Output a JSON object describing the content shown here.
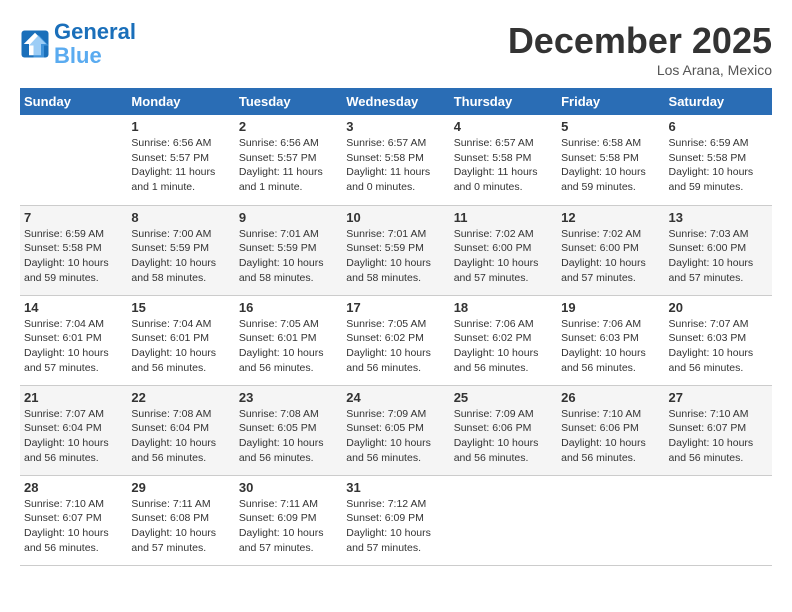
{
  "header": {
    "logo_line1": "General",
    "logo_line2": "Blue",
    "month": "December 2025",
    "location": "Los Arana, Mexico"
  },
  "days_of_week": [
    "Sunday",
    "Monday",
    "Tuesday",
    "Wednesday",
    "Thursday",
    "Friday",
    "Saturday"
  ],
  "weeks": [
    [
      {
        "day": "",
        "info": ""
      },
      {
        "day": "1",
        "info": "Sunrise: 6:56 AM\nSunset: 5:57 PM\nDaylight: 11 hours and 1 minute."
      },
      {
        "day": "2",
        "info": "Sunrise: 6:56 AM\nSunset: 5:57 PM\nDaylight: 11 hours and 1 minute."
      },
      {
        "day": "3",
        "info": "Sunrise: 6:57 AM\nSunset: 5:58 PM\nDaylight: 11 hours and 0 minutes."
      },
      {
        "day": "4",
        "info": "Sunrise: 6:57 AM\nSunset: 5:58 PM\nDaylight: 11 hours and 0 minutes."
      },
      {
        "day": "5",
        "info": "Sunrise: 6:58 AM\nSunset: 5:58 PM\nDaylight: 10 hours and 59 minutes."
      },
      {
        "day": "6",
        "info": "Sunrise: 6:59 AM\nSunset: 5:58 PM\nDaylight: 10 hours and 59 minutes."
      }
    ],
    [
      {
        "day": "7",
        "info": "Sunrise: 6:59 AM\nSunset: 5:58 PM\nDaylight: 10 hours and 59 minutes."
      },
      {
        "day": "8",
        "info": "Sunrise: 7:00 AM\nSunset: 5:59 PM\nDaylight: 10 hours and 58 minutes."
      },
      {
        "day": "9",
        "info": "Sunrise: 7:01 AM\nSunset: 5:59 PM\nDaylight: 10 hours and 58 minutes."
      },
      {
        "day": "10",
        "info": "Sunrise: 7:01 AM\nSunset: 5:59 PM\nDaylight: 10 hours and 58 minutes."
      },
      {
        "day": "11",
        "info": "Sunrise: 7:02 AM\nSunset: 6:00 PM\nDaylight: 10 hours and 57 minutes."
      },
      {
        "day": "12",
        "info": "Sunrise: 7:02 AM\nSunset: 6:00 PM\nDaylight: 10 hours and 57 minutes."
      },
      {
        "day": "13",
        "info": "Sunrise: 7:03 AM\nSunset: 6:00 PM\nDaylight: 10 hours and 57 minutes."
      }
    ],
    [
      {
        "day": "14",
        "info": "Sunrise: 7:04 AM\nSunset: 6:01 PM\nDaylight: 10 hours and 57 minutes."
      },
      {
        "day": "15",
        "info": "Sunrise: 7:04 AM\nSunset: 6:01 PM\nDaylight: 10 hours and 56 minutes."
      },
      {
        "day": "16",
        "info": "Sunrise: 7:05 AM\nSunset: 6:01 PM\nDaylight: 10 hours and 56 minutes."
      },
      {
        "day": "17",
        "info": "Sunrise: 7:05 AM\nSunset: 6:02 PM\nDaylight: 10 hours and 56 minutes."
      },
      {
        "day": "18",
        "info": "Sunrise: 7:06 AM\nSunset: 6:02 PM\nDaylight: 10 hours and 56 minutes."
      },
      {
        "day": "19",
        "info": "Sunrise: 7:06 AM\nSunset: 6:03 PM\nDaylight: 10 hours and 56 minutes."
      },
      {
        "day": "20",
        "info": "Sunrise: 7:07 AM\nSunset: 6:03 PM\nDaylight: 10 hours and 56 minutes."
      }
    ],
    [
      {
        "day": "21",
        "info": "Sunrise: 7:07 AM\nSunset: 6:04 PM\nDaylight: 10 hours and 56 minutes."
      },
      {
        "day": "22",
        "info": "Sunrise: 7:08 AM\nSunset: 6:04 PM\nDaylight: 10 hours and 56 minutes."
      },
      {
        "day": "23",
        "info": "Sunrise: 7:08 AM\nSunset: 6:05 PM\nDaylight: 10 hours and 56 minutes."
      },
      {
        "day": "24",
        "info": "Sunrise: 7:09 AM\nSunset: 6:05 PM\nDaylight: 10 hours and 56 minutes."
      },
      {
        "day": "25",
        "info": "Sunrise: 7:09 AM\nSunset: 6:06 PM\nDaylight: 10 hours and 56 minutes."
      },
      {
        "day": "26",
        "info": "Sunrise: 7:10 AM\nSunset: 6:06 PM\nDaylight: 10 hours and 56 minutes."
      },
      {
        "day": "27",
        "info": "Sunrise: 7:10 AM\nSunset: 6:07 PM\nDaylight: 10 hours and 56 minutes."
      }
    ],
    [
      {
        "day": "28",
        "info": "Sunrise: 7:10 AM\nSunset: 6:07 PM\nDaylight: 10 hours and 56 minutes."
      },
      {
        "day": "29",
        "info": "Sunrise: 7:11 AM\nSunset: 6:08 PM\nDaylight: 10 hours and 57 minutes."
      },
      {
        "day": "30",
        "info": "Sunrise: 7:11 AM\nSunset: 6:09 PM\nDaylight: 10 hours and 57 minutes."
      },
      {
        "day": "31",
        "info": "Sunrise: 7:12 AM\nSunset: 6:09 PM\nDaylight: 10 hours and 57 minutes."
      },
      {
        "day": "",
        "info": ""
      },
      {
        "day": "",
        "info": ""
      },
      {
        "day": "",
        "info": ""
      }
    ]
  ]
}
